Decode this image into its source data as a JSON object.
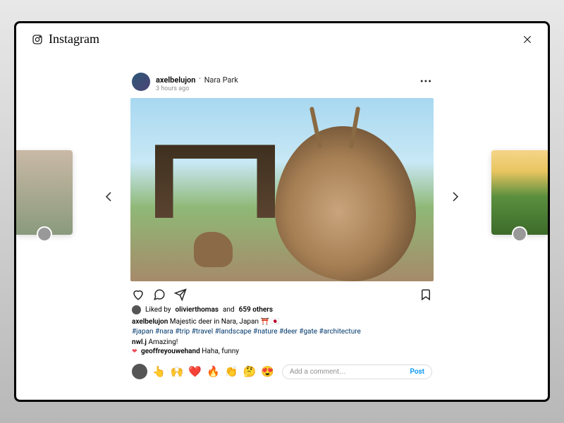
{
  "brand": "Instagram",
  "close": "×",
  "post": {
    "username": "axelbelujon",
    "location": "Nara Park",
    "timestamp": "3 hours ago",
    "more": "•••"
  },
  "likes": {
    "prefix": "Liked by",
    "liker": "olivierthomas",
    "and": "and",
    "count": "659 others"
  },
  "caption": {
    "user": "axelbelujon",
    "text": "Majestic deer in Nara, Japan ⛩️ 🇯🇵",
    "hashtags": "#japan #nara #trip #travel #landscape #nature #deer #gate #architecture"
  },
  "comments": [
    {
      "user": "nwl.j",
      "text": "Amazing!"
    },
    {
      "user": "geoffreyouwehand",
      "text": "Haha, funny",
      "liked": true
    }
  ],
  "reactions": [
    "👆",
    "🙌",
    "❤️",
    "🔥",
    "👏",
    "🤔",
    "😍"
  ],
  "comment_input": {
    "placeholder": "Add a comment…",
    "post_label": "Post"
  }
}
